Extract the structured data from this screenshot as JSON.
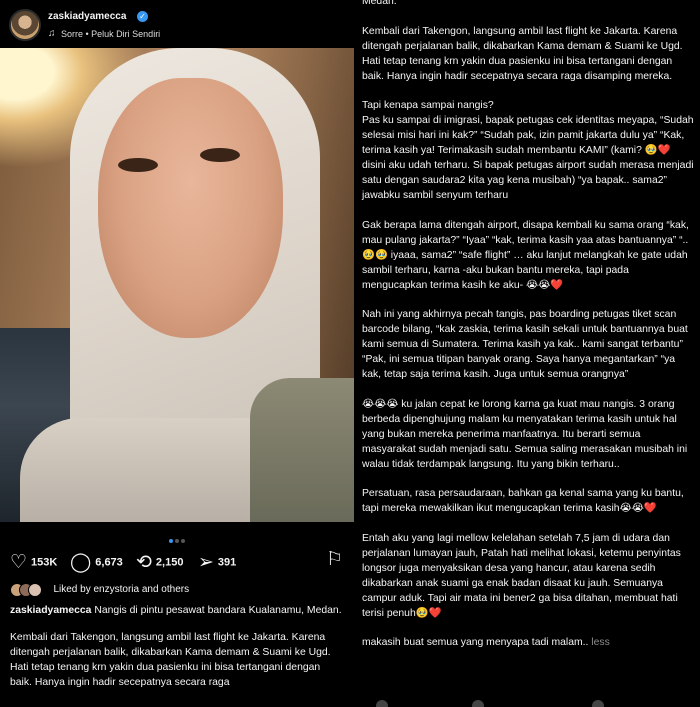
{
  "post": {
    "username": "zaskiadyamecca",
    "music": "Sorre • Peluk Diri Sendiri"
  },
  "icons": {
    "verified": "verified-badge-icon",
    "music": "music-note-icon",
    "mute": "speaker-muted-icon",
    "like": "heart-icon",
    "comment": "comment-bubble-icon",
    "repost": "repost-icon",
    "share": "paper-plane-icon",
    "save": "bookmark-icon"
  },
  "actions": {
    "likes": "153K",
    "comments": "6,673",
    "reposts": "2,150",
    "shares": "391"
  },
  "liked_by": "Liked by enzystoria and others",
  "caption_left": {
    "username": "zaskiadyamecca",
    "p1": "Nangis di pintu pesawat bandara Kualanamu, Medan.",
    "p2": "Kembali dari Takengon, langsung ambil last flight ke Jakarta. Karena ditengah perjalanan balik, dikabarkan Kama demam & Suami ke Ugd. Hati tetap tenang krn yakin dua pasienku ini bisa tertangani dengan baik. Hanya ingin hadir secepatnya secara raga"
  },
  "caption_right": {
    "p0": "Medan.",
    "p1": "Kembali dari Takengon, langsung ambil last flight ke Jakarta. Karena ditengah perjalanan balik, dikabarkan Kama demam & Suami ke Ugd. Hati tetap tenang krn yakin dua pasienku ini bisa tertangani dengan baik. Hanya ingin hadir secepatnya secara raga disamping mereka.",
    "p2": "Tapi kenapa sampai nangis?\nPas ku sampai di imigrasi, bapak petugas cek identitas meyapa, “Sudah selesai misi hari ini kak?” “Sudah pak, izin pamit jakarta dulu ya” “Kak, terima kasih ya! Terimakasih sudah membantu KAMI” (kami? 🥹❤️ disini aku udah terharu. Si bapak petugas airport sudah merasa menjadi satu dengan saudara2 kita yag kena musibah) “ya bapak.. sama2” jawabku sambil senyum terharu",
    "p3": "Gak berapa lama ditengah airport, disapa kembali ku sama orang “kak, mau pulang jakarta?” “Iyaa” “kak, terima kasih yaa atas bantuannya” “..🥹🥹 iyaaa, sama2” “safe flight” … aku lanjut melangkah ke gate udah sambil terharu, karna -aku bukan bantu mereka, tapi pada mengucapkan terima kasih ke aku- 😭😭❤️",
    "p4": "Nah ini yang akhirnya pecah tangis, pas boarding petugas tiket scan barcode bilang, “kak zaskia, terima kasih sekali untuk bantuannya buat kami semua di Sumatera. Terima kasih ya kak.. kami sangat terbantu” “Pak, ini semua titipan banyak orang. Saya hanya megantarkan” “ya kak, tetap saja terima kasih. Juga untuk semua orangnya”",
    "p5": "😭😭😭 ku jalan cepat ke lorong karna ga kuat mau nangis. 3 orang berbeda dipenghujung malam ku menyatakan terima kasih untuk hal yang bukan mereka penerima manfaatnya. Itu berarti semua masyarakat sudah menjadi satu. Semua saling  merasakan musibah ini walau tidak terdampak langsung. Itu yang bikin terharu..",
    "p6": "Persatuan, rasa persaudaraan, bahkan ga kenal sama yang ku bantu, tapi mereka mewakilkan ikut mengucapkan terima kasih😭😭❤️",
    "p7": "Entah aku yang lagi mellow kelelahan setelah 7,5 jam di udara dan perjalanan lumayan jauh, Patah hati melihat lokasi, ketemu penyintas longsor juga menyaksikan desa yang hancur, atau karena sedih dikabarkan anak suami ga enak badan disaat ku jauh. Semuanya campur aduk. Tapi air mata ini bener2 ga bisa ditahan, membuat hati terisi penuh🥹❤️",
    "p8": "makasih buat semua yang menyapa tadi malam..",
    "more": "less"
  }
}
